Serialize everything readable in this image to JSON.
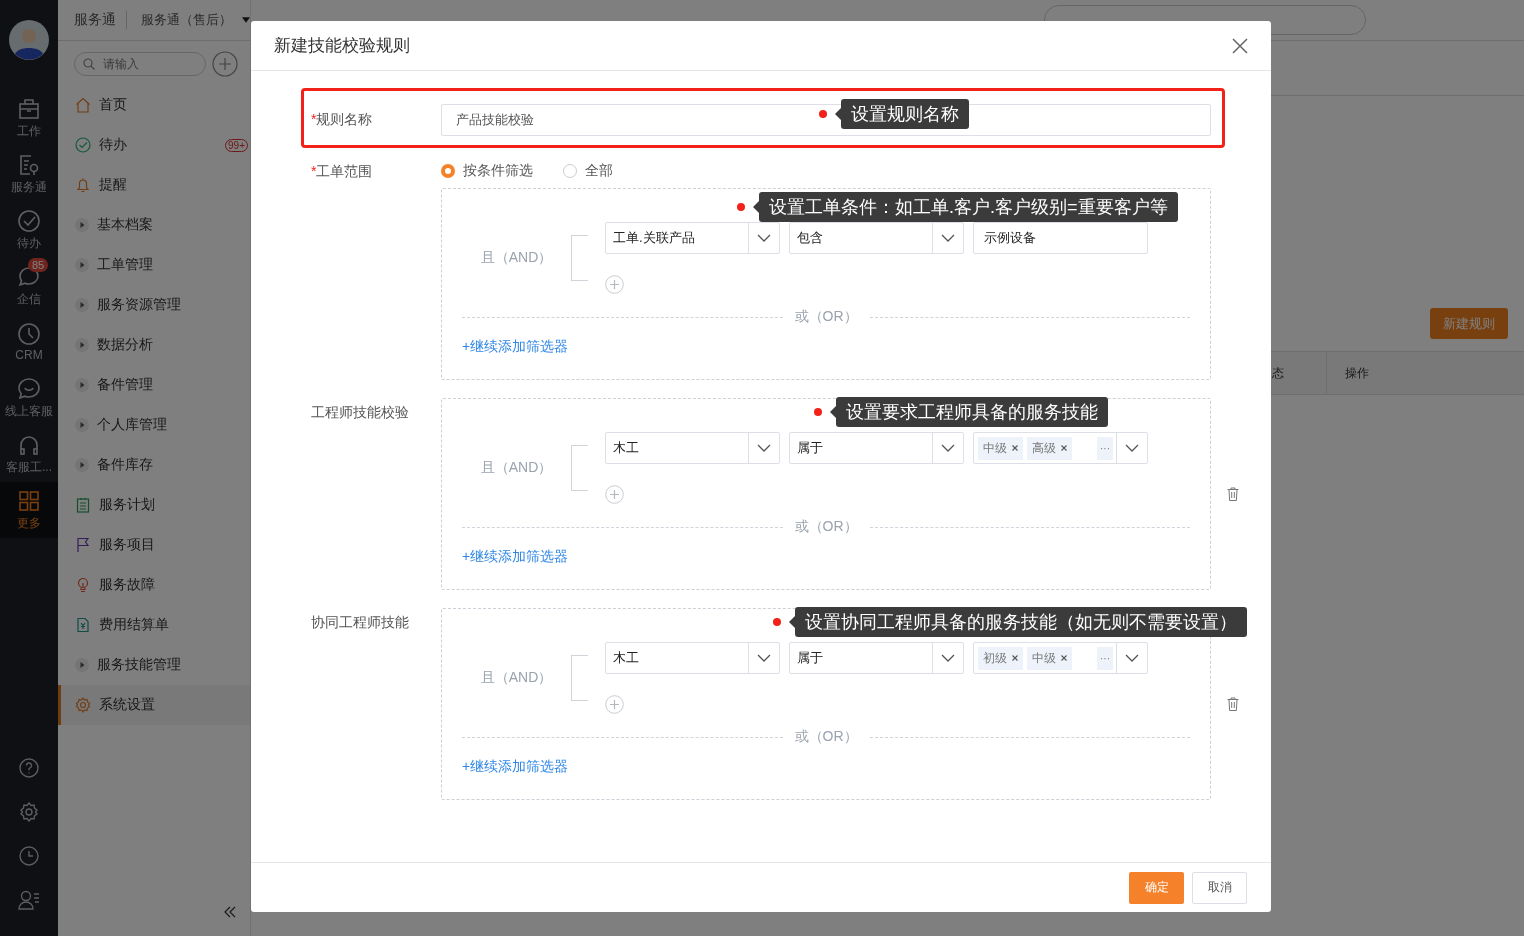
{
  "rail": {
    "items": [
      {
        "label": "工作",
        "selected": false
      },
      {
        "label": "服务通",
        "selected": false
      },
      {
        "label": "待办",
        "selected": false
      },
      {
        "label": "企信",
        "selected": false,
        "badge": "85"
      },
      {
        "label": "CRM",
        "selected": false
      },
      {
        "label": "线上客服",
        "selected": false
      },
      {
        "label": "客服工...",
        "selected": false
      },
      {
        "label": "更多",
        "selected": true
      }
    ]
  },
  "header": {
    "app": "服务通",
    "module": "服务通（售后）"
  },
  "menu": {
    "search_placeholder": "请输入",
    "items": [
      {
        "label": "首页",
        "kind": "page",
        "selected": false
      },
      {
        "label": "待办",
        "kind": "page",
        "selected": false,
        "badge": "99+"
      },
      {
        "label": "提醒",
        "kind": "page",
        "selected": false
      },
      {
        "label": "基本档案",
        "kind": "group",
        "selected": false
      },
      {
        "label": "工单管理",
        "kind": "group",
        "selected": false
      },
      {
        "label": "服务资源管理",
        "kind": "group",
        "selected": false
      },
      {
        "label": "数据分析",
        "kind": "group",
        "selected": false
      },
      {
        "label": "备件管理",
        "kind": "group",
        "selected": false
      },
      {
        "label": "个人库管理",
        "kind": "group",
        "selected": false
      },
      {
        "label": "备件库存",
        "kind": "group",
        "selected": false
      },
      {
        "label": "服务计划",
        "kind": "page",
        "selected": false
      },
      {
        "label": "服务项目",
        "kind": "page",
        "selected": false
      },
      {
        "label": "服务故障",
        "kind": "page",
        "selected": false
      },
      {
        "label": "费用结算单",
        "kind": "page",
        "selected": false
      },
      {
        "label": "服务技能管理",
        "kind": "group",
        "selected": false
      },
      {
        "label": "系统设置",
        "kind": "page",
        "selected": true
      }
    ]
  },
  "background": {
    "new_button": "新建规则",
    "columns": [
      "态",
      "操作"
    ]
  },
  "modal": {
    "title": "新建技能校验规则",
    "rule_name": {
      "required_mark": "*",
      "label": "规则名称",
      "value": "产品技能校验",
      "callout": "设置规则名称"
    },
    "scope": {
      "required_mark": "*",
      "label": "工单范围",
      "options": [
        {
          "label": "按条件筛选",
          "selected": true
        },
        {
          "label": "全部",
          "selected": false
        }
      ],
      "filter": {
        "callout": "设置工单条件：如工单.客户.客户级别=重要客户等",
        "and_label": "且（AND）",
        "or_label": "或（OR）",
        "add_link": "+继续添加筛选器",
        "deletable": false,
        "conditions": [
          {
            "field": "工单.关联产品",
            "operator": "包含",
            "kind": "text",
            "value": "示例设备"
          }
        ]
      }
    },
    "skill_groups": [
      {
        "label": "工程师技能校验",
        "filter": {
          "callout": "设置要求工程师具备的服务技能",
          "and_label": "且（AND）",
          "or_label": "或（OR）",
          "add_link": "+继续添加筛选器",
          "deletable": true,
          "conditions": [
            {
              "field": "木工",
              "operator": "属于",
              "kind": "tags",
              "tags": [
                "中级",
                "高级"
              ],
              "more": "···"
            }
          ]
        }
      },
      {
        "label": "协同工程师技能",
        "filter": {
          "callout": "设置协同工程师具备的服务技能（如无则不需要设置）",
          "and_label": "且（AND）",
          "or_label": "或（OR）",
          "add_link": "+继续添加筛选器",
          "deletable": true,
          "conditions": [
            {
              "field": "木工",
              "operator": "属于",
              "kind": "tags",
              "tags": [
                "初级",
                "中级"
              ],
              "more": "···"
            }
          ]
        }
      }
    ],
    "confirm": "确定",
    "cancel": "取消"
  }
}
